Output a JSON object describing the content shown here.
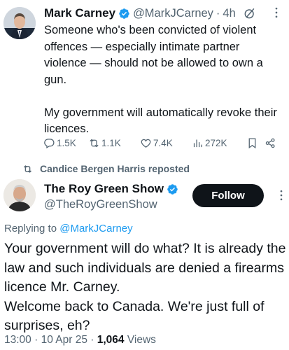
{
  "tweet1": {
    "author_name": "Mark Carney",
    "handle": "@MarkJCarney",
    "separator": "·",
    "time": "4h",
    "text": "Someone who's been convicted of violent offences — especially intimate partner violence — should not be allowed to own a gun.\n\nMy government will automatically revoke their licences.",
    "stats": {
      "replies": "1.5K",
      "reposts": "1.1K",
      "likes": "7.4K",
      "views": "272K"
    },
    "icons": [
      "verified-badge-icon",
      "grok-icon",
      "more-icon",
      "reply-icon",
      "repost-icon",
      "like-icon",
      "views-icon",
      "bookmark-icon",
      "share-icon"
    ]
  },
  "repost_banner": {
    "text": "Candice Bergen Harris reposted",
    "icon": "repost-icon"
  },
  "tweet2": {
    "author_name": "The Roy Green Show",
    "handle": "@TheRoyGreenShow",
    "follow_label": "Follow",
    "replying_prefix": "Replying to ",
    "replying_to": "@MarkJCarney",
    "text": "Your government will do what? It is already the law and such individuals are denied a firearms licence Mr. Carney.\nWelcome back to Canada. We're just full of surprises, eh?",
    "time": "13:00",
    "dot": " · ",
    "date": "10 Apr 25",
    "dot2": " · ",
    "views_count": "1,064",
    "views_label": " Views"
  },
  "colors": {
    "text": "#0f1419",
    "secondary": "#536471",
    "accent": "#1d9bf0",
    "follow_bg": "#0f1419"
  }
}
